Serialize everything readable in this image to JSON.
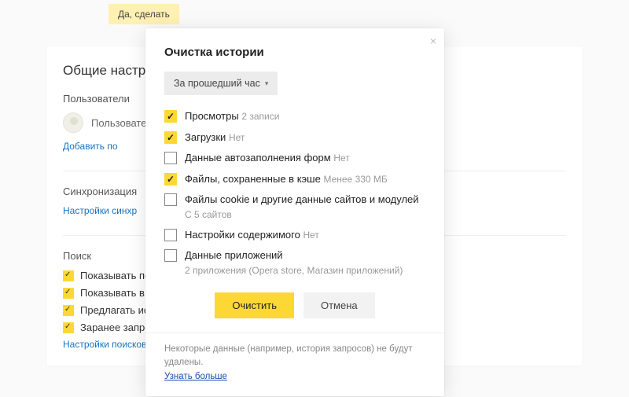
{
  "bg": {
    "top_button": "Да, сделать",
    "title": "Общие настро",
    "users_section": "Пользователи",
    "user_label": "Пользовател",
    "add_user": "Добавить по",
    "sync_section": "Синхронизация",
    "sync_link": "Настройки синхр",
    "search_section": "Поиск",
    "search_items": [
      "Показывать по",
      "Показывать в У",
      "Предлагать ис",
      "Заранее запро"
    ],
    "search_link": "Настройки поисковой системы"
  },
  "modal": {
    "title": "Очистка истории",
    "range": "За прошедший час",
    "options": [
      {
        "checked": true,
        "label": "Просмотры",
        "sub": "2 записи"
      },
      {
        "checked": true,
        "label": "Загрузки",
        "sub": "Нет"
      },
      {
        "checked": false,
        "label": "Данные автозаполнения форм",
        "sub": "Нет"
      },
      {
        "checked": true,
        "label": "Файлы, сохраненные в кэше",
        "sub": "Менее 330 МБ"
      },
      {
        "checked": false,
        "label": "Файлы cookie и другие данные сайтов и модулей",
        "sub_block": "С 5 сайтов"
      },
      {
        "checked": false,
        "label": "Настройки содержимого",
        "sub": "Нет"
      },
      {
        "checked": false,
        "label": "Данные приложений",
        "sub_block": "2 приложения (Opera store, Магазин приложений)"
      }
    ],
    "clear_btn": "Очистить",
    "cancel_btn": "Отмена",
    "footer_note": "Некоторые данные (например, история запросов) не будут удалены.",
    "footer_link": "Узнать больше"
  }
}
